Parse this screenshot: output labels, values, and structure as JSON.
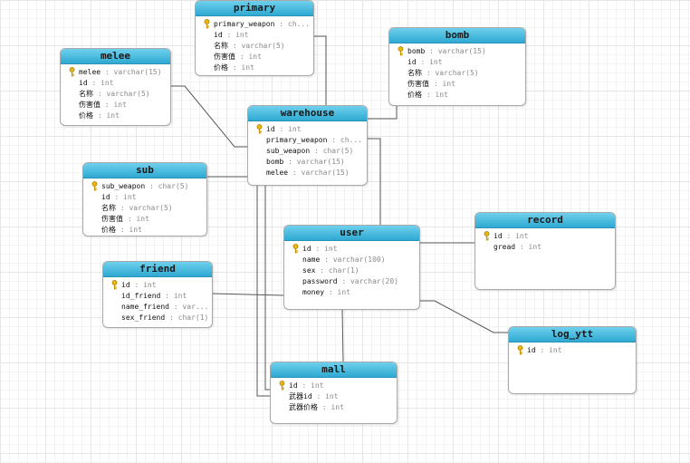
{
  "diagram": {
    "tables": [
      {
        "id": "primary",
        "name": "primary",
        "fields": [
          {
            "name": "primary_weapon",
            "type": "ch...",
            "key": true
          },
          {
            "name": "id",
            "type": "int"
          },
          {
            "name": "名称",
            "type": "varchar(5)"
          },
          {
            "name": "伤害值",
            "type": "int"
          },
          {
            "name": "价格",
            "type": "int"
          }
        ]
      },
      {
        "id": "melee",
        "name": "melee",
        "fields": [
          {
            "name": "melee",
            "type": "varchar(15)",
            "key": true
          },
          {
            "name": "id",
            "type": "int"
          },
          {
            "name": "名称",
            "type": "varchar(5)"
          },
          {
            "name": "伤害值",
            "type": "int"
          },
          {
            "name": "价格",
            "type": "int"
          }
        ]
      },
      {
        "id": "bomb",
        "name": "bomb",
        "fields": [
          {
            "name": "bomb",
            "type": "varchar(15)",
            "key": true
          },
          {
            "name": "id",
            "type": "int"
          },
          {
            "name": "名称",
            "type": "varchar(5)"
          },
          {
            "name": "伤害值",
            "type": "int"
          },
          {
            "name": "价格",
            "type": "int"
          }
        ]
      },
      {
        "id": "warehouse",
        "name": "warehouse",
        "fields": [
          {
            "name": "id",
            "type": "int",
            "key": true
          },
          {
            "name": "primary_weapon",
            "type": "ch..."
          },
          {
            "name": "sub_weapon",
            "type": "char(5)"
          },
          {
            "name": "bomb",
            "type": "varchar(15)"
          },
          {
            "name": "melee",
            "type": "varchar(15)"
          }
        ]
      },
      {
        "id": "sub",
        "name": "sub",
        "fields": [
          {
            "name": "sub_weapon",
            "type": "char(5)",
            "key": true
          },
          {
            "name": "id",
            "type": "int"
          },
          {
            "name": "名称",
            "type": "varchar(5)"
          },
          {
            "name": "伤害值",
            "type": "int"
          },
          {
            "name": "价格",
            "type": "int"
          }
        ]
      },
      {
        "id": "user",
        "name": "user",
        "fields": [
          {
            "name": "id",
            "type": "int",
            "key": true
          },
          {
            "name": "name",
            "type": "varchar(100)"
          },
          {
            "name": "sex",
            "type": "char(1)"
          },
          {
            "name": "password",
            "type": "varchar(20)"
          },
          {
            "name": "money",
            "type": "int"
          }
        ]
      },
      {
        "id": "record",
        "name": "record",
        "fields": [
          {
            "name": "id",
            "type": "int",
            "key": true
          },
          {
            "name": "gread",
            "type": "int"
          }
        ]
      },
      {
        "id": "friend",
        "name": "friend",
        "fields": [
          {
            "name": "id",
            "type": "int",
            "key": true
          },
          {
            "name": "id_friend",
            "type": "int"
          },
          {
            "name": "name_friend",
            "type": "var..."
          },
          {
            "name": "sex_friend",
            "type": "char(1)"
          }
        ]
      },
      {
        "id": "log_ytt",
        "name": "log_ytt",
        "fields": [
          {
            "name": "id",
            "type": "int",
            "key": true
          }
        ]
      },
      {
        "id": "mall",
        "name": "mall",
        "fields": [
          {
            "name": "id",
            "type": "int",
            "key": true
          },
          {
            "name": "武器id",
            "type": "int"
          },
          {
            "name": "武器价格",
            "type": "int"
          }
        ]
      }
    ]
  }
}
